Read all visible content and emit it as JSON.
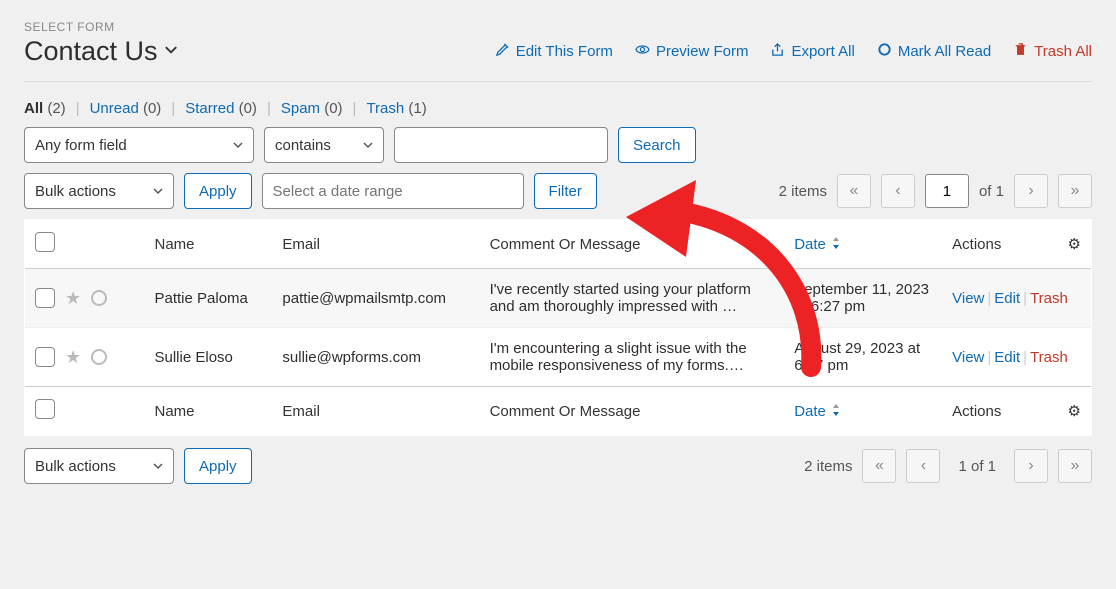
{
  "selectFormLabel": "SELECT FORM",
  "formTitle": "Contact Us",
  "toolbar": {
    "edit": "Edit This Form",
    "preview": "Preview Form",
    "export": "Export All",
    "markRead": "Mark All Read",
    "trash": "Trash All"
  },
  "status": {
    "all": {
      "label": "All",
      "count": "(2)"
    },
    "unread": {
      "label": "Unread",
      "count": "(0)"
    },
    "starred": {
      "label": "Starred",
      "count": "(0)"
    },
    "spam": {
      "label": "Spam",
      "count": "(0)"
    },
    "trash": {
      "label": "Trash",
      "count": "(1)"
    }
  },
  "filters": {
    "fieldSelect": "Any form field",
    "operatorSelect": "contains",
    "searchBtn": "Search",
    "bulk": "Bulk actions",
    "apply": "Apply",
    "datePlaceholder": "Select a date range",
    "filterBtn": "Filter"
  },
  "pagination": {
    "itemsText": "2 items",
    "current": "1",
    "ofText": "of 1",
    "ofTextBottom": "1 of 1"
  },
  "columns": {
    "name": "Name",
    "email": "Email",
    "message": "Comment Or Message",
    "date": "Date",
    "actions": "Actions"
  },
  "rowActions": {
    "view": "View",
    "edit": "Edit",
    "trash": "Trash"
  },
  "rows": [
    {
      "name": "Pattie Paloma",
      "email": "pattie@wpmailsmtp.com",
      "message": "I've recently started using your platform and am thoroughly impressed with …",
      "date": "September 11, 2023 at 6:27 pm"
    },
    {
      "name": "Sullie Eloso",
      "email": "sullie@wpforms.com",
      "message": "I'm encountering a slight issue with the mobile responsiveness of my forms.…",
      "date": "August 29, 2023 at 6:27 pm"
    }
  ]
}
